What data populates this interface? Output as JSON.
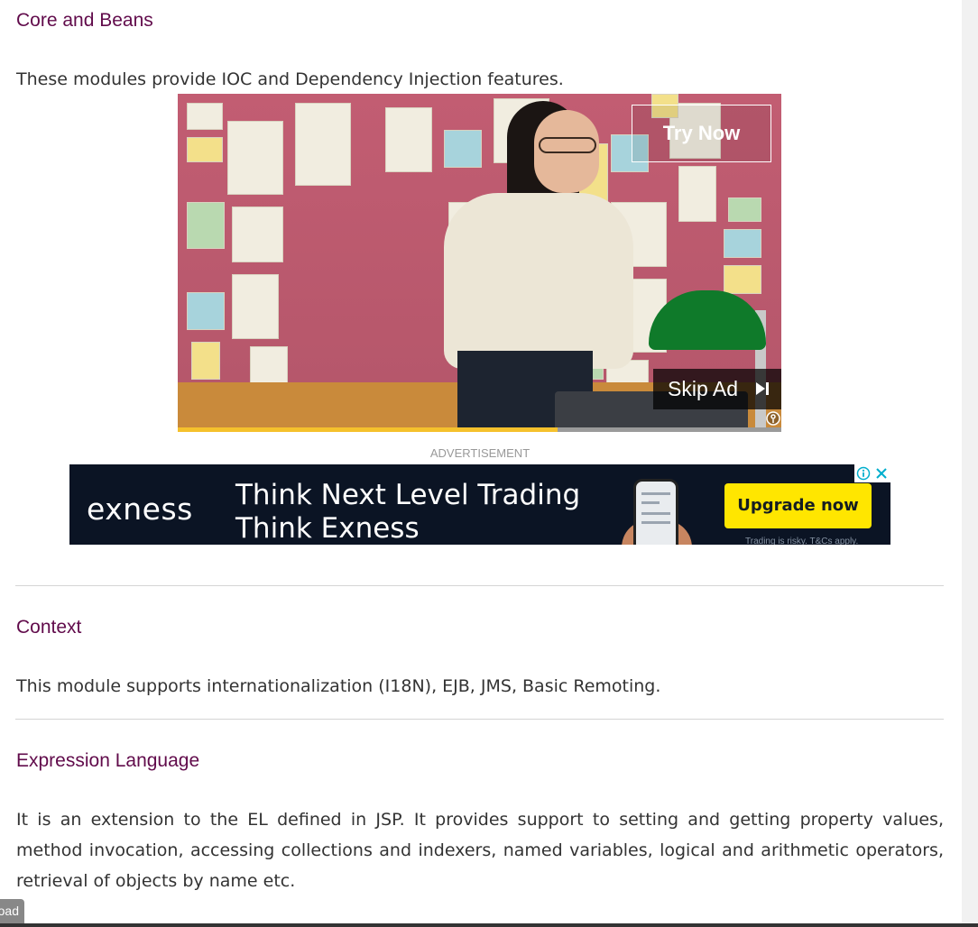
{
  "sections": {
    "core": {
      "title": "Core and Beans",
      "text": "These modules provide IOC and Dependency Injection features."
    },
    "context": {
      "title": "Context",
      "text": "This module supports internationalization (I18N), EJB, JMS, Basic Remoting."
    },
    "el": {
      "title": "Expression Language",
      "text": "It is an extension to the EL defined in JSP. It provides support to setting and getting property values, method invocation, accessing collections and indexers, named variables, logical and arithmetic operators, retrieval of objects by name etc."
    }
  },
  "video_ad": {
    "cta_label": "Try Now",
    "skip_label": "Skip Ad",
    "skip_icon": "skip-forward-icon",
    "info_icon": "ad-info-icon",
    "progress_fraction": 0.63
  },
  "advertisement_label": "ADVERTISEMENT",
  "banner_ad": {
    "brand": "exness",
    "headline_line1": "Think Next Level Trading",
    "headline_line2": "Think Exness",
    "cta_label": "Upgrade now",
    "disclaimer": "Trading is risky. T&Cs apply.",
    "info_icon": "adchoices-icon",
    "close_icon": "close-icon"
  },
  "load_tag": "oad",
  "colors": {
    "heading": "#610b4b",
    "banner_bg": "#0b1424",
    "cta_yellow": "#ffe600",
    "progress": "#f5c12c"
  }
}
